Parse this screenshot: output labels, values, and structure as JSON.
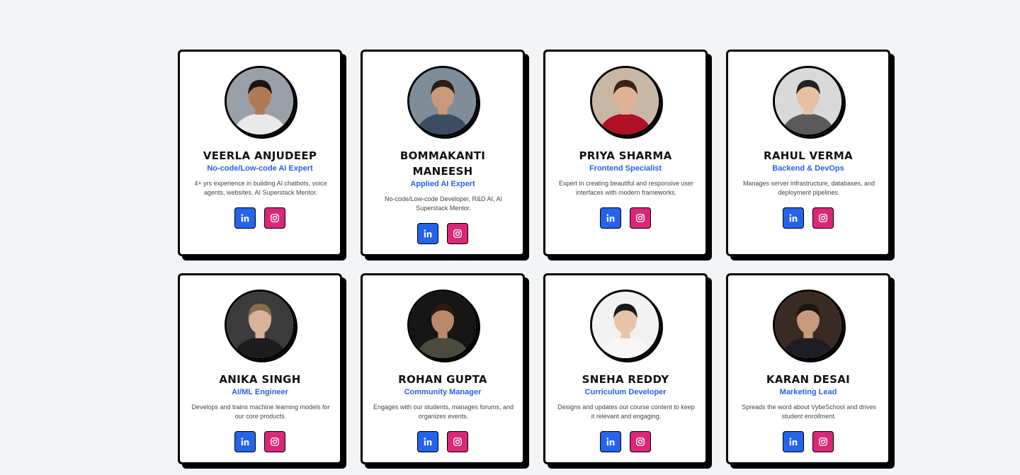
{
  "team": [
    {
      "name": "VEERLA ANJUDEEP",
      "role": "No-code/Low-code AI Expert",
      "description": "4+ yrs experience in building AI chatbots, voice agents, websites. AI Superstack Mentor.",
      "photo_colors": {
        "bg": "#9aa0a8",
        "skin": "#b07a55",
        "hair": "#1b1511",
        "shirt": "#e9e9e9"
      },
      "icons": [
        "linkedin-icon",
        "instagram-icon"
      ]
    },
    {
      "name": "BOMMAKANTI MANEESH",
      "role": "Applied AI Expert",
      "description": "No-code/Low-code Developer, R&D AI, AI Superstack Mentor.",
      "photo_colors": {
        "bg": "#7f8d99",
        "skin": "#c89a7b",
        "hair": "#2a1d15",
        "shirt": "#3c4c63"
      },
      "icons": [
        "linkedin-icon",
        "instagram-icon"
      ]
    },
    {
      "name": "PRIYA SHARMA",
      "role": "Frontend Specialist",
      "description": "Expert in creating beautiful and responsive user interfaces with modern frameworks.",
      "photo_colors": {
        "bg": "#c9b7a6",
        "skin": "#e0b293",
        "hair": "#3a2216",
        "shirt": "#b01028"
      },
      "icons": [
        "linkedin-icon",
        "instagram-icon"
      ]
    },
    {
      "name": "RAHUL VERMA",
      "role": "Backend & DevOps",
      "description": "Manages server infrastructure, databases, and deployment pipelines.",
      "photo_colors": {
        "bg": "#d9d9d9",
        "skin": "#e6c0a3",
        "hair": "#222222",
        "shirt": "#5a5a5a"
      },
      "icons": [
        "linkedin-icon",
        "instagram-icon"
      ]
    },
    {
      "name": "ANIKA SINGH",
      "role": "AI/ML Engineer",
      "description": "Develops and trains machine learning models for our core products.",
      "photo_colors": {
        "bg": "#3b3b3b",
        "skin": "#d8b49a",
        "hair": "#8a6a48",
        "shirt": "#1c1c1c"
      },
      "icons": [
        "linkedin-icon",
        "instagram-icon"
      ]
    },
    {
      "name": "ROHAN GUPTA",
      "role": "Community Manager",
      "description": "Engages with our students, manages forums, and organizes events.",
      "photo_colors": {
        "bg": "#151515",
        "skin": "#b98a6a",
        "hair": "#2a1a10",
        "shirt": "#4a4a3e"
      },
      "icons": [
        "linkedin-icon",
        "instagram-icon"
      ]
    },
    {
      "name": "SNEHA REDDY",
      "role": "Curriculum Developer",
      "description": "Designs and updates our course content to keep it relevant and engaging.",
      "photo_colors": {
        "bg": "#f2f2f2",
        "skin": "#e8c3a8",
        "hair": "#1a1a1a",
        "shirt": "#f7f7f7"
      },
      "icons": [
        "linkedin-icon",
        "instagram-icon"
      ]
    },
    {
      "name": "KARAN DESAI",
      "role": "Marketing Lead",
      "description": "Spreads the word about VybeSchool and drives student enrollment.",
      "photo_colors": {
        "bg": "#3a2a24",
        "skin": "#c79a7d",
        "hair": "#1b1410",
        "shirt": "#1e1e22"
      },
      "icons": [
        "linkedin-icon",
        "instagram-icon"
      ]
    }
  ],
  "colors": {
    "page_bg": "#f3f4f6",
    "accent_blue": "#2563eb",
    "linkedin_bg": "#2563eb",
    "instagram_bg": "#db2777",
    "card_border": "#000000"
  }
}
